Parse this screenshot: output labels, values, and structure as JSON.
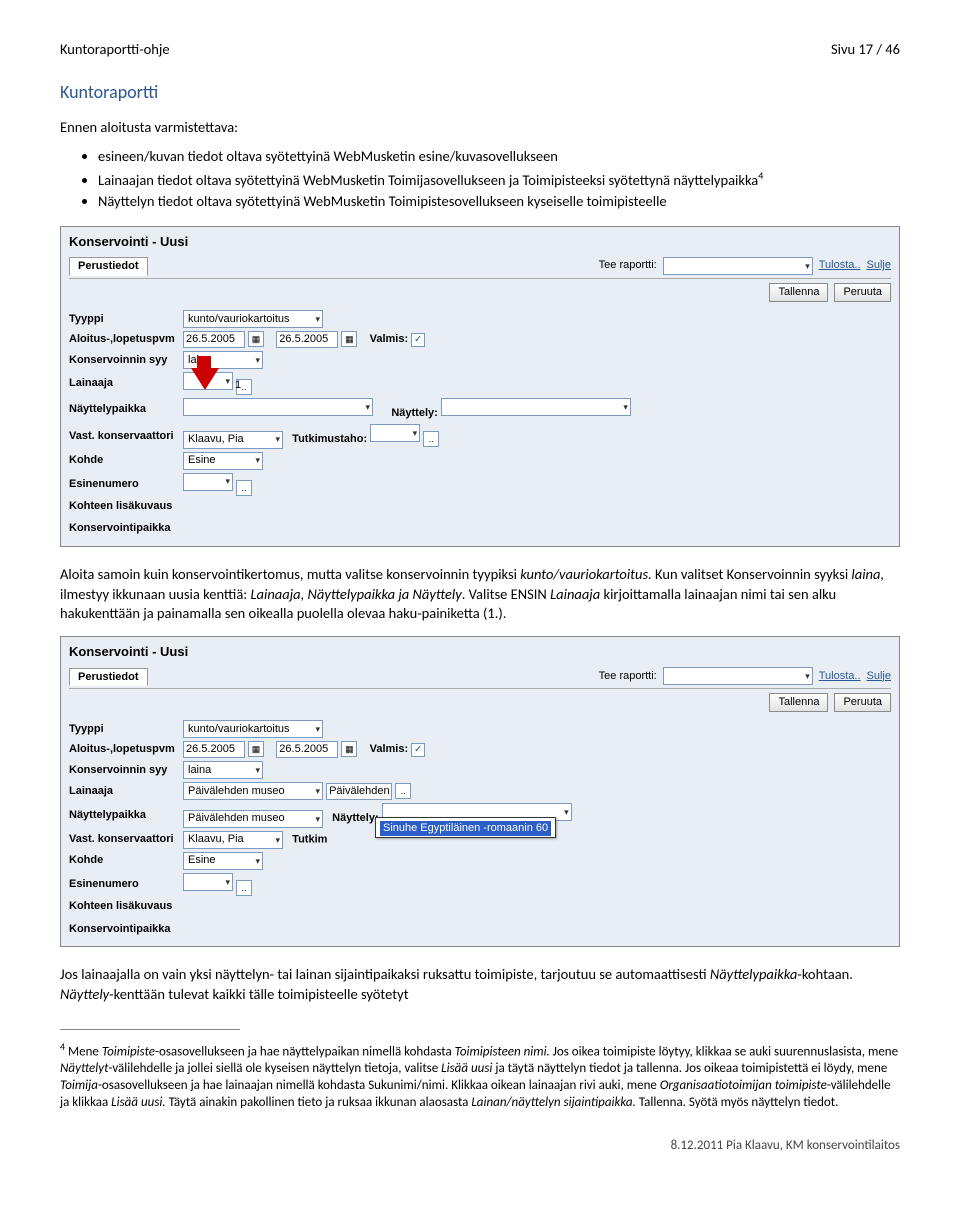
{
  "header": {
    "left": "Kuntoraportti-ohje",
    "right": "Sivu 17 / 46"
  },
  "title": "Kuntoraportti",
  "intro": "Ennen aloitusta varmistettava:",
  "bullets": [
    "esineen/kuvan tiedot oltava syötettyinä WebMusketin esine/kuvasovellukseen",
    "Lainaajan tiedot oltava syötettyinä WebMusketin Toimijasovellukseen ja Toimipisteeksi syötettynä näyttelypaikka",
    "Näyttelyn tiedot oltava syötettyinä WebMusketin Toimipistesovellukseen kyseiselle toimipisteelle"
  ],
  "sup4": "4",
  "shot_common": {
    "win_title": "Konservointi  - Uusi",
    "tab_label": "Perustiedot",
    "tee_raportti": "Tee raportti:",
    "tulosta": "Tulosta..",
    "sulje": "Sulje",
    "tallenna": "Tallenna",
    "peruuta": "Peruuta",
    "labels": {
      "tyyppi": "Tyyppi",
      "aloitus": "Aloitus-,lopetuspvm",
      "valmis": "Valmis:",
      "syy": "Konservoinnin syy",
      "lainaaja": "Lainaaja",
      "nayttelypaikka": "Näyttelypaikka",
      "nayttely": "Näyttely:",
      "vast": "Vast. konservaattori",
      "tutkimustaho": "Tutkimustaho:",
      "kohde": "Kohde",
      "esinenumero": "Esinenumero",
      "lisakuvaus": "Kohteen lisäkuvaus",
      "konspaikka": "Konservointipaikka"
    },
    "values": {
      "tyyppi": "kunto/vauriokartoitus",
      "date1": "26.5.2005",
      "date2": "26.5.2005",
      "syy": "laina",
      "vast": "Klaavu, Pia",
      "kohde": "Esine"
    }
  },
  "shot1": {
    "arrow_num": "1"
  },
  "shot2": {
    "lainaaja": "Päivälehden museo",
    "nayttelypaikka": "Päivälehden museo",
    "suggest_top": "Päivälehden",
    "suggest_hit": "Sinuhe Egyptiläinen -romaanin 60",
    "tutkim_abbrev": "Tutkim"
  },
  "para1a": "Aloita samoin kuin konservointikertomus, mutta valitse konservoinnin tyypiksi ",
  "para1b": "kunto/vauriokartoitus.",
  "para1c": " Kun valitset Konservoinnin syyksi ",
  "para1d": "laina,",
  "para1e": " ilmestyy ikkunaan uusia kenttiä: ",
  "para1f": "Lainaaja, Näyttelypaikka ja Näyttely",
  "para1g": ". Valitse ENSIN ",
  "para1h": "Lainaaja",
  "para1i": " kirjoittamalla lainaajan nimi tai sen alku hakukenttään ja painamalla sen oikealla puolella olevaa haku-painiketta (1.).",
  "para2a": "Jos lainaajalla on vain yksi näyttelyn- tai lainan sijaintipaikaksi ruksattu toimipiste, tarjoutuu se automaattisesti ",
  "para2b": "Näyttelypaikka",
  "para2c": "-kohtaan. ",
  "para2d": "Näyttely",
  "para2e": "-kenttään tulevat kaikki tälle toimipisteelle syötetyt",
  "footnote": {
    "num": "4",
    "a": " Mene ",
    "b": "Toimipiste",
    "c": "-osasovellukseen ja hae näyttelypaikan nimellä kohdasta ",
    "d": "Toimipisteen nimi.",
    "e": " Jos oikea toimipiste löytyy, klikkaa se auki suurennuslasista, mene ",
    "f": "Näyttelyt",
    "g": "-välilehdelle ja jollei siellä ole kyseisen näyttelyn tietoja, valitse ",
    "h": "Lisää uusi",
    "i": " ja täytä näyttelyn tiedot ja tallenna. Jos oikeaa toimipistettä ei löydy, mene ",
    "j": "Toimija",
    "k": "-osasovellukseen ja hae lainaajan nimellä kohdasta Sukunimi/nimi. Klikkaa oikean lainaajan rivi auki, mene ",
    "l": "Organisaatiotoimijan toimipiste",
    "m": "-välilehdelle ja klikkaa ",
    "n": "Lisää uusi.",
    "o": " Täytä ainakin pakollinen tieto ja ruksaa ikkunan alaosasta ",
    "p": "Lainan/näyttelyn sijaintipaikka.",
    "q": " Tallenna. Syötä myös näyttelyn tiedot."
  },
  "footer": "8.12.2011 Pia Klaavu, KM konservointilaitos"
}
